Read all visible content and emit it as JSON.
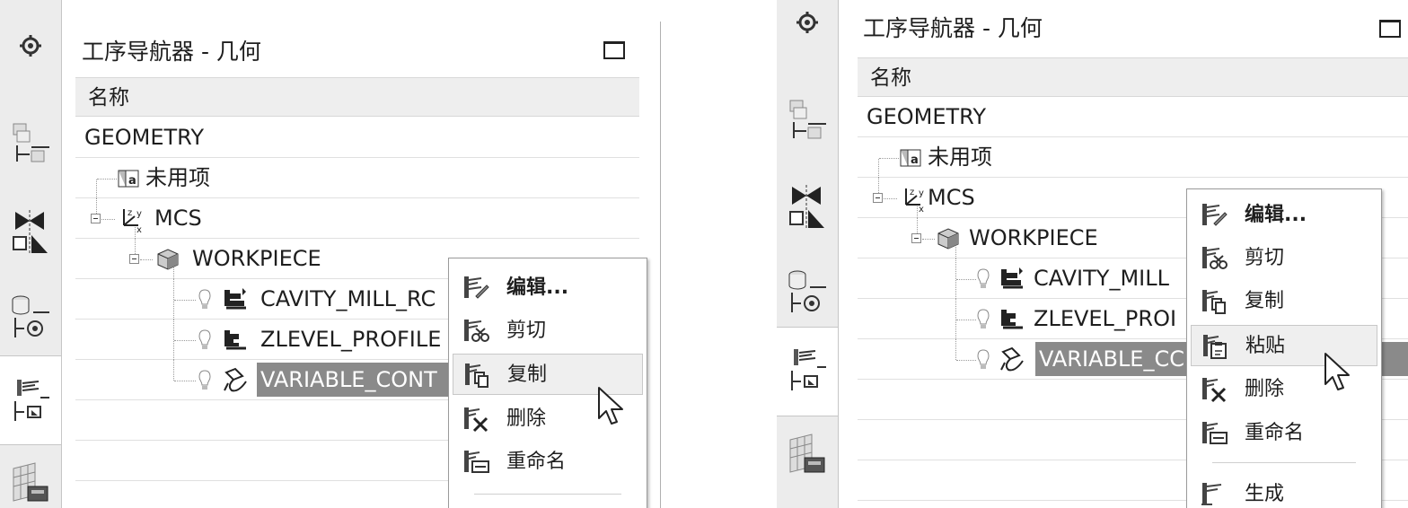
{
  "left": {
    "title": "工序导航器 - 几何",
    "column_header": "名称",
    "tree": [
      {
        "label": "GEOMETRY"
      },
      {
        "label": "未用项",
        "icon": "unused-items-icon"
      },
      {
        "label": "MCS",
        "icon": "mcs-axes-icon"
      },
      {
        "label": "WORKPIECE",
        "icon": "workpiece-icon"
      },
      {
        "label": "CAVITY_MILL_RC",
        "icon": "cavity-mill-icon"
      },
      {
        "label": "ZLEVEL_PROFILE",
        "icon": "zlevel-profile-icon"
      },
      {
        "label": "VARIABLE_CONT",
        "icon": "variable-contour-icon",
        "selected": true
      }
    ],
    "menu": [
      {
        "label": "编辑...",
        "icon": "edit-icon"
      },
      {
        "label": "剪切",
        "icon": "cut-icon"
      },
      {
        "label": "复制",
        "icon": "copy-icon",
        "hover": true
      },
      {
        "label": "删除",
        "icon": "delete-icon"
      },
      {
        "label": "重命名",
        "icon": "rename-icon"
      }
    ]
  },
  "right": {
    "title": "工序导航器 - 几何",
    "column_header": "名称",
    "tree": [
      {
        "label": "GEOMETRY"
      },
      {
        "label": "未用项",
        "icon": "unused-items-icon"
      },
      {
        "label": "MCS",
        "icon": "mcs-axes-icon"
      },
      {
        "label": "WORKPIECE",
        "icon": "workpiece-icon"
      },
      {
        "label": "CAVITY_MILL",
        "icon": "cavity-mill-icon"
      },
      {
        "label": "ZLEVEL_PROI",
        "icon": "zlevel-profile-icon"
      },
      {
        "label": "VARIABLE_CC",
        "icon": "variable-contour-icon",
        "selected": true
      }
    ],
    "menu": [
      {
        "label": "编辑...",
        "icon": "edit-icon"
      },
      {
        "label": "剪切",
        "icon": "cut-icon"
      },
      {
        "label": "复制",
        "icon": "copy-icon"
      },
      {
        "label": "粘贴",
        "icon": "paste-icon",
        "hover": true
      },
      {
        "label": "删除",
        "icon": "delete-icon"
      },
      {
        "label": "重命名",
        "icon": "rename-icon"
      },
      {
        "label": "生成",
        "icon": "generate-icon"
      }
    ]
  },
  "sidebar_icons": [
    "settings-gear-icon",
    "part-navigator-icon",
    "assembly-constraint-icon",
    "machine-tool-navigator-icon",
    "operation-navigator-icon",
    "library-icon"
  ],
  "colors": {
    "selection": "#8a8a8a",
    "sidebar": "#ececec",
    "header": "#eeeeee"
  }
}
